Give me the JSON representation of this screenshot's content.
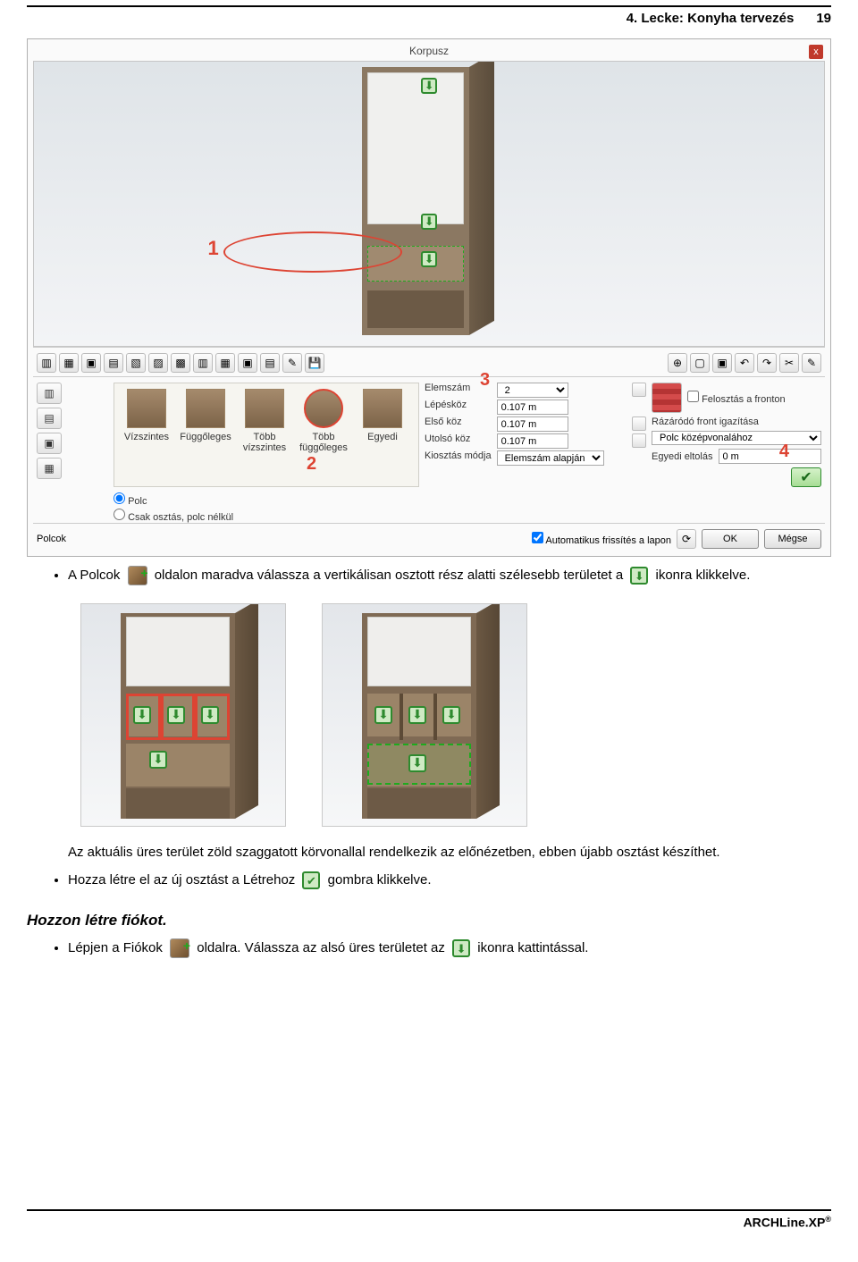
{
  "header": {
    "title": "4. Lecke: Konyha tervezés",
    "page": "19"
  },
  "korpusz": {
    "title": "Korpusz",
    "annotations": {
      "n1": "1",
      "n2": "2",
      "n3": "3",
      "n4": "4"
    },
    "thumbs": [
      "Vízszintes",
      "Függőleges",
      "Több vízszintes",
      "Több függőleges",
      "Egyedi"
    ],
    "fields": {
      "elemszam_label": "Elemszám",
      "elemszam_value": "2",
      "lepeskoz_label": "Lépésköz",
      "lepeskoz_value": "0.107 m",
      "elsokoz_label": "Első köz",
      "elsokoz_value": "0.107 m",
      "utolsokoz_label": "Utolsó köz",
      "utolsokoz_value": "0.107 m",
      "kiosztas_label": "Kiosztás módja",
      "kiosztas_value": "Elemszám alapján"
    },
    "right": {
      "felosztas_label": "Felosztás a fronton",
      "igazitas_label": "Rázáródó front igazítása",
      "igazitas_value": "Polc középvonalához",
      "eltolas_label": "Egyedi eltolás",
      "eltolas_value": "0 m"
    },
    "radios": {
      "polc": "Polc",
      "csak": "Csak osztás, polc nélkül"
    },
    "footer": {
      "left_label": "Polcok",
      "auto_label": "Automatikus frissítés a lapon",
      "ok": "OK",
      "cancel": "Mégse"
    }
  },
  "text": {
    "l1a": "A Polcok",
    "l1b": "oldalon maradva válassza a vertikálisan osztott rész alatti szélesebb területet a",
    "l1c": "ikonra klikkelve.",
    "l2": "Az aktuális üres terület zöld szaggatott körvonallal rendelkezik az előnézetben, ebben újabb osztást készíthet.",
    "l3a": "Hozza létre el az új osztást a Létrehoz",
    "l3b": "gombra klikkelve.",
    "h1": "Hozzon létre fiókot.",
    "l4a": "Lépjen a Fiókok",
    "l4b": "oldalra. Válassza az alsó üres területet az",
    "l4c": "ikonra kattintással."
  },
  "footer": {
    "brand": "ARCHLine.XP",
    "reg": "®"
  }
}
